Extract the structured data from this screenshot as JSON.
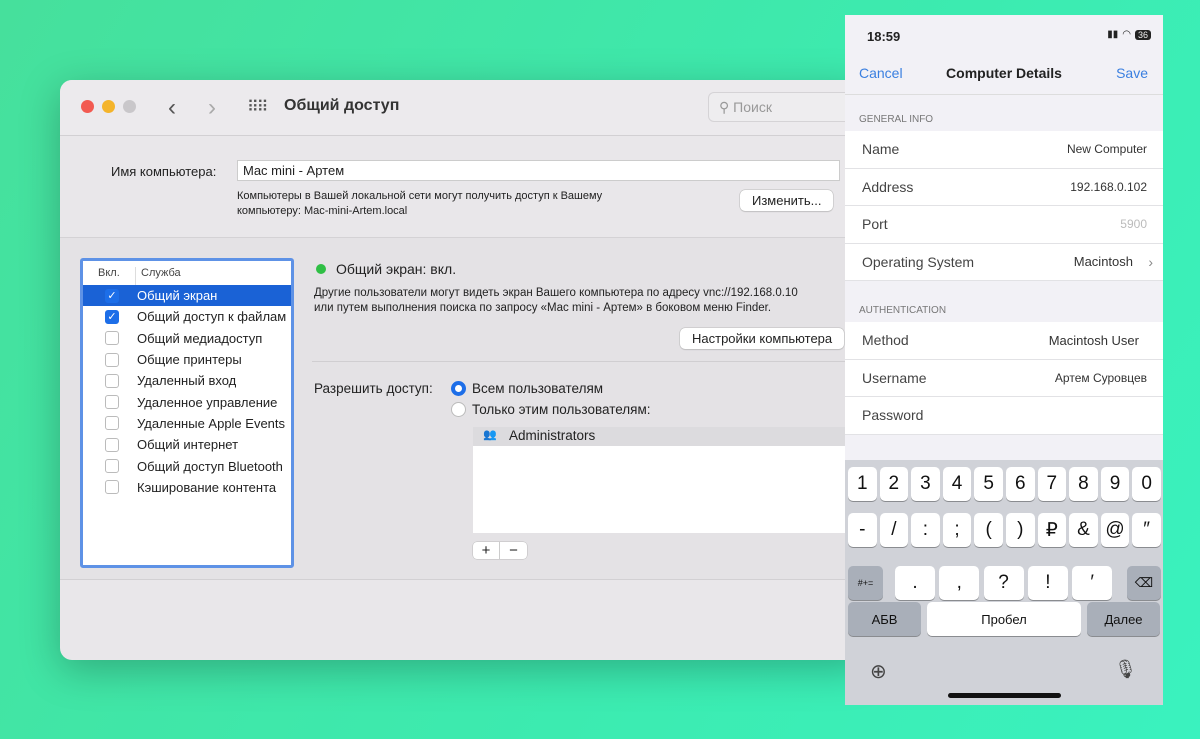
{
  "mac": {
    "title": "Общий доступ",
    "search_placeholder": "Поиск",
    "name_label": "Имя компьютера:",
    "name_value": "Mac mini - Артем",
    "name_hint_1": "Компьютеры в Вашей локальной сети могут получить доступ к Вашему",
    "name_hint_2": "компьютеру: Mac-mini-Artem.local",
    "edit_button": "Изменить...",
    "list_header": {
      "on": "Вкл.",
      "service": "Служба"
    },
    "services": [
      {
        "label": "Общий экран",
        "checked": true,
        "selected": true
      },
      {
        "label": "Общий доступ к файлам",
        "checked": true
      },
      {
        "label": "Общий медиадоступ",
        "checked": false
      },
      {
        "label": "Общие принтеры",
        "checked": false
      },
      {
        "label": "Удаленный вход",
        "checked": false
      },
      {
        "label": "Удаленное управление",
        "checked": false
      },
      {
        "label": "Удаленные Apple Events",
        "checked": false
      },
      {
        "label": "Общий интернет",
        "checked": false
      },
      {
        "label": "Общий доступ Bluetooth",
        "checked": false
      },
      {
        "label": "Кэширование контента",
        "checked": false
      }
    ],
    "status": "Общий экран: вкл.",
    "desc_1": "Другие пользователи могут видеть экран Вашего компьютера по адресу vnc://192.168.0.10",
    "desc_2": "или путем выполнения поиска по запросу «Mac mini - Артем» в боковом меню Finder.",
    "settings_button": "Настройки компьютера",
    "allow_label": "Разрешить доступ:",
    "radio_all": "Всем пользователям",
    "radio_only": "Только этим пользователям:",
    "users": [
      "Administrators"
    ],
    "add": "+",
    "remove": "−"
  },
  "phone": {
    "time": "18:59",
    "battery": "36",
    "cancel": "Cancel",
    "title": "Computer Details",
    "save": "Save",
    "general": "GENERAL INFO",
    "fields": [
      {
        "label": "Name",
        "value": "New Computer"
      },
      {
        "label": "Address",
        "value": "192.168.0.102"
      },
      {
        "label": "Port",
        "value": "5900"
      },
      {
        "label": "Operating System",
        "value": "Macintosh"
      }
    ],
    "auth": "AUTHENTICATION",
    "auth_fields": [
      {
        "label": "Method",
        "value": "Macintosh User"
      },
      {
        "label": "Username",
        "value": "Артем Суровцев"
      },
      {
        "label": "Password",
        "value": ""
      }
    ],
    "keys_row1": [
      "1",
      "2",
      "3",
      "4",
      "5",
      "6",
      "7",
      "8",
      "9",
      "0"
    ],
    "keys_row2": [
      "-",
      "/",
      ":",
      ";",
      "(",
      ")",
      "₽",
      "&",
      "@",
      "″"
    ],
    "keys_row3": [
      ".",
      ",",
      "?",
      "!",
      "′"
    ],
    "shift": "#+=",
    "abc": "АБВ",
    "space": "Пробел",
    "next": "Далее"
  }
}
